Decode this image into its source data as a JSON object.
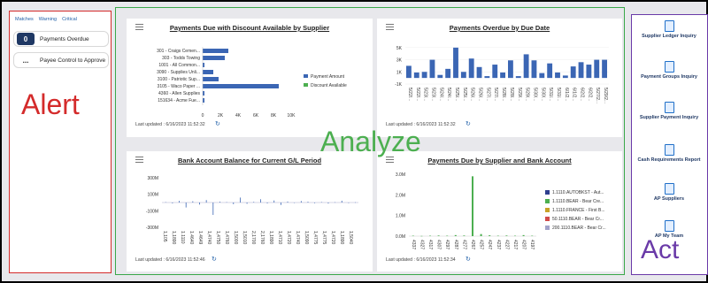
{
  "alert": {
    "tabs": [
      "Matches",
      "Warning",
      "Critical"
    ],
    "items": [
      {
        "badge": "0",
        "label": "Payments Overdue"
      },
      {
        "badge": "...",
        "label": "Payee Control to Approve"
      }
    ],
    "overlay_label": "Alert"
  },
  "analyze": {
    "overlay_label": "Analyze",
    "cards": [
      {
        "title": "Payments Due with Discount Available by Supplier",
        "updated": "Last updated : 6/16/2023 11:52:32",
        "legend": [
          "Payment Amount",
          "Discount Available"
        ],
        "x_ticks": [
          "0",
          "2K",
          "4K",
          "6K",
          "8K",
          "10K"
        ]
      },
      {
        "title": "Payments Overdue by Due Date",
        "updated": "Last updated : 6/16/2023 11:52:32",
        "y_ticks": [
          "5K",
          "3K",
          "1K",
          "-1K"
        ]
      },
      {
        "title": "Bank Account Balance for Current G/L Period",
        "updated": "Last updated : 6/16/2023 11:52:46",
        "y_ticks": [
          "300M",
          "100M",
          "-100M",
          "-300M"
        ]
      },
      {
        "title": "Payments Due by Supplier and Bank Account",
        "updated": "Last updated : 6/16/2023 11:52:34",
        "y_ticks": [
          "3.0M",
          "2.0M",
          "1.0M",
          "0.0M"
        ],
        "legend": [
          "1.1110.AUTOBKST - Aut...",
          "1.1110.BEAR - Bear Cre...",
          "1.1110.FRANCE - First B...",
          "50.1110.BEAR - Bear Cr...",
          "200.1110.BEAR - Bear Cr..."
        ]
      }
    ]
  },
  "chart_data": [
    {
      "type": "bar",
      "title": "Payments Due with Discount Available by Supplier",
      "categories": [
        "301 - Craigs Cemen...",
        "303 - Todds Towing",
        "1001 - All Common...",
        "3090 - Supplies Unli...",
        "3100 - Patriotic Sup...",
        "3105 - Waco Paper ...",
        "4360 - Allen Supplies",
        "151634 - Acme Fue..."
      ],
      "series": [
        {
          "name": "Payment Amount",
          "values": [
            2900,
            2500,
            200,
            1200,
            1800,
            8600,
            200,
            200
          ]
        },
        {
          "name": "Discount Available",
          "values": [
            0,
            0,
            0,
            0,
            0,
            0,
            0,
            0
          ]
        }
      ],
      "xlim": [
        0,
        10000
      ],
      "legend": "right"
    },
    {
      "type": "bar",
      "title": "Payments Overdue by Due Date",
      "categories": [
        "5/22/...",
        "5/22/...",
        "5/23/...",
        "5/23/...",
        "5/24/...",
        "5/24/...",
        "5/25/...",
        "5/25/...",
        "5/26/...",
        "5/26/...",
        "5/27/...",
        "5/27/...",
        "5/28/...",
        "5/28/...",
        "5/29/...",
        "5/29/...",
        "5/30/...",
        "5/30/...",
        "5/31/...",
        "5/31/...",
        "6/1/2...",
        "6/1/2...",
        "6/2/2...",
        "6/2/2...",
        "5/27/2...",
        "5/29/2..."
      ],
      "values": [
        2000,
        900,
        1000,
        3000,
        500,
        1500,
        5000,
        1000,
        3200,
        1800,
        300,
        2200,
        900,
        2900,
        300,
        3900,
        2900,
        800,
        2400,
        900,
        400,
        1900,
        2600,
        2200,
        3000,
        3000
      ],
      "ylim": [
        -1000,
        6000
      ]
    },
    {
      "type": "bar",
      "title": "Bank Account Balance for Current G/L Period",
      "values": [
        5,
        -10,
        20,
        -60,
        15,
        -25,
        30,
        -150,
        10,
        5,
        -20,
        60,
        -15,
        8,
        40,
        -10,
        25,
        -30,
        12,
        -5,
        18,
        10,
        -8,
        6,
        -12,
        4,
        22,
        -6,
        3
      ],
      "ylim": [
        -300,
        300
      ]
    },
    {
      "type": "bar",
      "title": "Payments Due by Supplier and Bank Account",
      "categories": [
        "4337",
        "4327",
        "4317",
        "4307",
        "4297",
        "4287",
        "4277",
        "4267",
        "4257",
        "4247",
        "4237",
        "4227",
        "4217",
        "4207",
        "4197"
      ],
      "series": [
        {
          "name": "1.1110.AUTOBKST - Aut...",
          "values": [
            0,
            0,
            0,
            0,
            0,
            0,
            0,
            0,
            0,
            0,
            0,
            0,
            0,
            0,
            0
          ]
        },
        {
          "name": "1.1110.BEAR - Bear Cre...",
          "values": [
            0.02,
            0.01,
            0.02,
            0.03,
            0.02,
            0.05,
            0.03,
            2.9,
            0.1,
            0.04,
            0.02,
            0.03,
            0.02,
            0.05,
            0.02
          ]
        },
        {
          "name": "1.1110.FRANCE - First B...",
          "values": [
            0,
            0,
            0,
            0,
            0,
            0,
            0,
            0,
            0,
            0,
            0,
            0,
            0,
            0,
            0
          ]
        },
        {
          "name": "50.1110.BEAR - Bear Cr...",
          "values": [
            0,
            0,
            0,
            0,
            0,
            0,
            0,
            0,
            0,
            0,
            0,
            0,
            0,
            0,
            0
          ]
        },
        {
          "name": "200.1110.BEAR - Bear Cr...",
          "values": [
            0,
            0,
            0,
            0,
            0,
            0,
            0,
            0,
            0,
            0,
            0,
            0,
            0,
            0,
            0
          ]
        }
      ],
      "ylim": [
        0,
        3
      ]
    }
  ],
  "act": {
    "overlay_label": "Act",
    "items": [
      {
        "label": "Supplier Ledger Inquiry"
      },
      {
        "label": "Payment Groups Inquiry"
      },
      {
        "label": "Supplier Payment Inquiry"
      },
      {
        "label": "Cash Requirements Report"
      },
      {
        "label": "AP Suppliers"
      },
      {
        "label": "AP My Team"
      }
    ]
  },
  "colors": {
    "bar_blue": "#3b66b4",
    "bar_green": "#4caf50",
    "alert_red": "#d42b2b",
    "analyze_green": "#4caf50",
    "act_purple": "#6a3aa8"
  }
}
